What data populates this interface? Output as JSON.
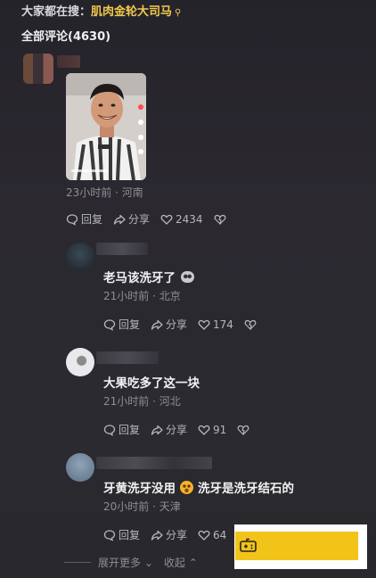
{
  "header": {
    "search_prefix": "大家都在搜：",
    "search_keyword": "肌肉金轮大司马",
    "comment_count": "全部评论(4630)"
  },
  "comments": [
    {
      "meta": "23小时前 · 河南",
      "reply_label": "回复",
      "share_label": "分享",
      "likes": "2434"
    },
    {
      "text": "老马该洗牙了",
      "meta": "21小时前 · 北京",
      "reply_label": "回复",
      "share_label": "分享",
      "likes": "174"
    },
    {
      "text": "大果吃多了这一块",
      "meta": "21小时前 · 河北",
      "reply_label": "回复",
      "share_label": "分享",
      "likes": "91"
    },
    {
      "text_a": "牙黄洗牙没用",
      "text_b": "洗牙是洗牙结石的",
      "meta": "20小时前 · 天津",
      "reply_label": "回复",
      "share_label": "分享",
      "likes": "64"
    }
  ],
  "footer": {
    "expand_more": "展开更多",
    "collapse": "收起"
  },
  "colors": {
    "keyword": "#f2c94c",
    "overlay_yellow": "#f2c318"
  }
}
